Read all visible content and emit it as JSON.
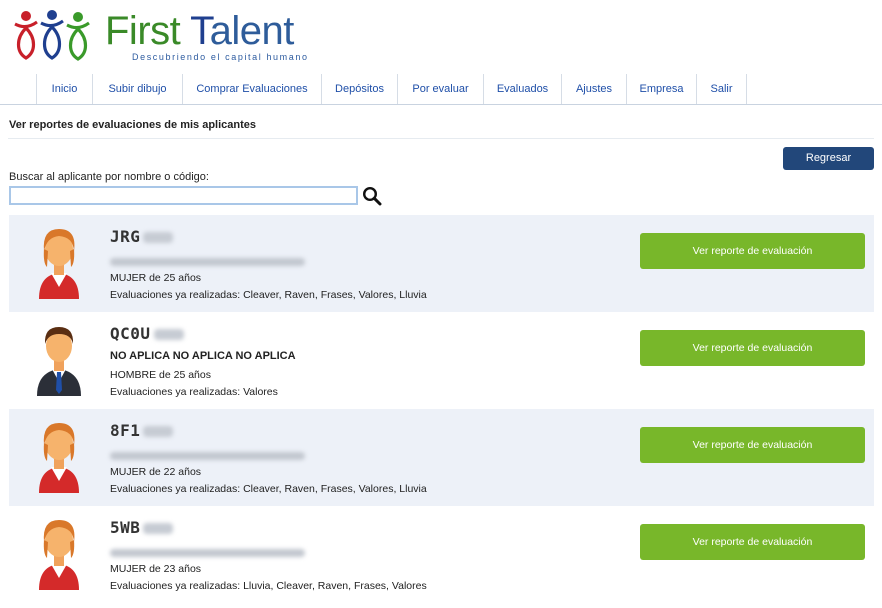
{
  "brand": {
    "name_first": "First",
    "name_t": "T",
    "name_rest": "alent",
    "tagline": "Descubriendo el capital humano"
  },
  "nav": {
    "items": [
      {
        "label": "Inicio"
      },
      {
        "label": "Subir dibujo"
      },
      {
        "label": "Comprar Evaluaciones"
      },
      {
        "label": "Depósitos"
      },
      {
        "label": "Por evaluar"
      },
      {
        "label": "Evaluados"
      },
      {
        "label": "Ajustes"
      },
      {
        "label": "Empresa"
      },
      {
        "label": "Salir"
      }
    ]
  },
  "page": {
    "title": "Ver reportes de evaluaciones de mis aplicantes",
    "back_button": "Regresar",
    "search_label": "Buscar al aplicante por nombre o código:",
    "search_value": ""
  },
  "applicants": [
    {
      "code": "JRG",
      "name": "",
      "gender_age": "MUJER de 25 años",
      "evaluations": "Evaluaciones ya realizadas: Cleaver, Raven, Frases, Valores, Lluvia",
      "button": "Ver reporte de evaluación",
      "avatar": "female-avatar"
    },
    {
      "code": "QC0U",
      "name": "NO APLICA NO APLICA NO APLICA",
      "gender_age": "HOMBRE de 25 años",
      "evaluations": "Evaluaciones ya realizadas: Valores",
      "button": "Ver reporte de evaluación",
      "avatar": "male-avatar"
    },
    {
      "code": "8F1",
      "name": "",
      "gender_age": "MUJER de 22 años",
      "evaluations": "Evaluaciones ya realizadas: Cleaver, Raven, Frases, Valores, Lluvia",
      "button": "Ver reporte de evaluación",
      "avatar": "female-avatar"
    },
    {
      "code": "5WB",
      "name": "",
      "gender_age": "MUJER de 23 años",
      "evaluations": "Evaluaciones ya realizadas: Lluvia, Cleaver, Raven, Frases, Valores",
      "button": "Ver reporte de evaluación",
      "avatar": "female-avatar"
    }
  ],
  "colors": {
    "nav_text": "#1f4fa8",
    "back_button": "#22477a",
    "report_button": "#78b72a",
    "row_shade": "#edf1f8"
  }
}
